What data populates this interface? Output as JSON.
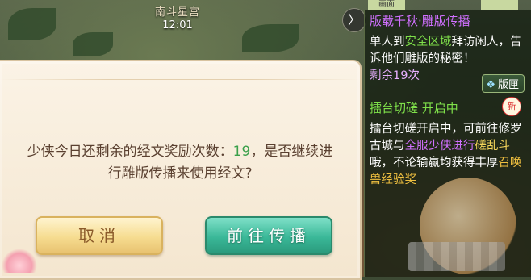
{
  "hud": {
    "map_name": "南斗星宫",
    "clock": "12:01",
    "chevron_glyph": "〉"
  },
  "news_panel": {
    "tab_stub": "画面",
    "item1": {
      "title": "版载千秋·雕版传播",
      "body_parts": [
        {
          "text": "单人到",
          "style": "white"
        },
        {
          "text": "安全区域",
          "style": "green"
        },
        {
          "text": "拜访闲人，告诉他们雕版的秘密！",
          "style": "white"
        }
      ],
      "remaining": "剩余19次",
      "badge_label": "版匣"
    },
    "item2": {
      "title": "擂台切磋 开启中",
      "new_tag": "新",
      "body_parts": [
        {
          "text": "擂台切磋开启中，可前往修罗古城与",
          "style": "white"
        },
        {
          "text": "全服少侠进行",
          "style": "purple"
        },
        {
          "text": "磋乱斗",
          "style": "yellow"
        },
        {
          "text": "哦",
          "style": "white"
        },
        {
          "text": "，不论输赢均获得丰厚",
          "style": "white"
        },
        {
          "text": "召唤兽经验奖",
          "style": "gold"
        }
      ]
    }
  },
  "dialog": {
    "message_prefix": "少侠今日还剩余的经文奖励次数：",
    "remaining_count": "19",
    "message_suffix": "，是否继续进行雕版传播来使用经文?",
    "cancel_label": "取消",
    "confirm_label": "前往传播"
  },
  "colors": {
    "accent_green": "#3aa04a",
    "dialog_bg": "#f4e6cf",
    "confirm_teal": "#3ab898",
    "cancel_gold": "#f6dc90"
  }
}
